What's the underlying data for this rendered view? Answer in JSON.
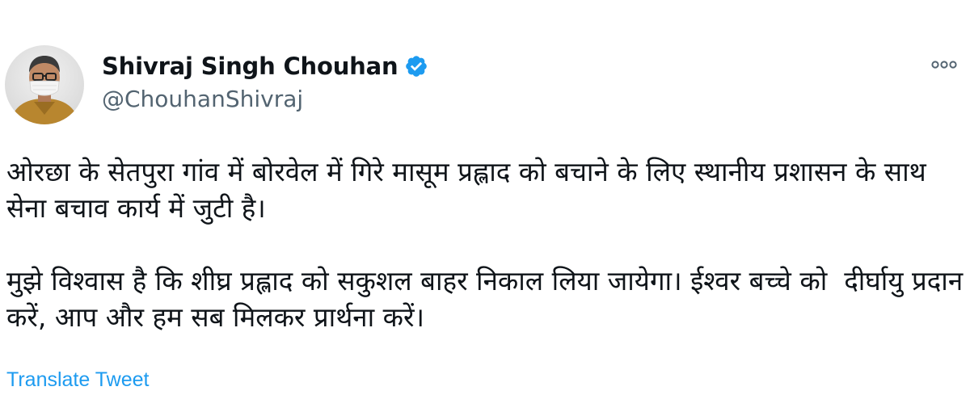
{
  "user": {
    "display_name": "Shivraj Singh Chouhan",
    "handle": "@ChouhanShivraj",
    "verified": true
  },
  "tweet": {
    "paragraphs": [
      "ओरछा के सेतपुरा गांव में बोरवेल में गिरे मासूम प्रह्लाद को बचाने के लिए स्थानीय प्रशासन के साथ सेना बचाव कार्य में जुटी है।",
      "मुझे विश्वास है कि शीघ्र प्रह्लाद को सकुशल बाहर निकाल लिया जायेगा। ईश्वर बच्चे को  दीर्घायु प्रदान करें, आप और हम सब मिलकर प्रार्थना करें।"
    ],
    "translate_label": "Translate Tweet"
  },
  "icons": {
    "verified": "verified-badge-icon",
    "more": "more-options-icon"
  },
  "colors": {
    "link": "#1d9bf0",
    "verified": "#1d9bf0",
    "secondary_text": "#536471",
    "primary_text": "#0f1419"
  }
}
